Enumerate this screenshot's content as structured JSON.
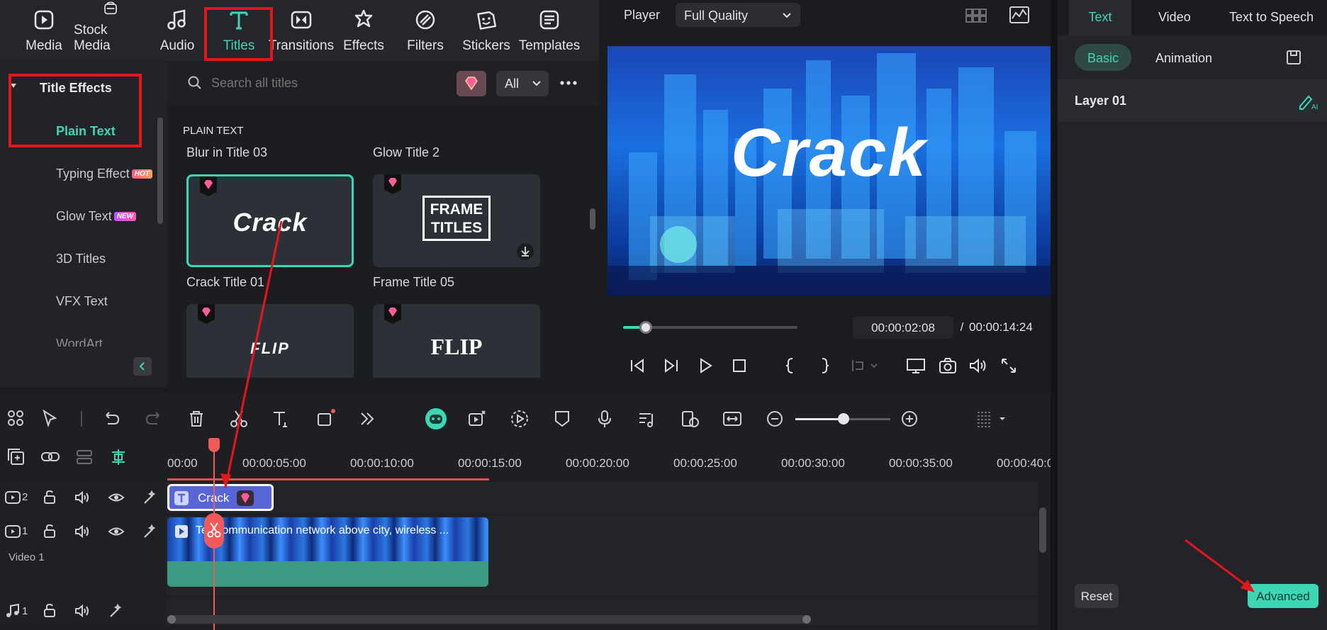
{
  "toolbar": {
    "items": [
      {
        "label": "Media",
        "icon": "media-icon"
      },
      {
        "label": "Stock Media",
        "icon": "stock-media-icon"
      },
      {
        "label": "Audio",
        "icon": "audio-icon"
      },
      {
        "label": "Titles",
        "icon": "titles-icon",
        "active": true
      },
      {
        "label": "Transitions",
        "icon": "transitions-icon"
      },
      {
        "label": "Effects",
        "icon": "effects-icon"
      },
      {
        "label": "Filters",
        "icon": "filters-icon"
      },
      {
        "label": "Stickers",
        "icon": "stickers-icon"
      },
      {
        "label": "Templates",
        "icon": "templates-icon"
      }
    ]
  },
  "categories": {
    "group_label": "Title Effects",
    "items": [
      {
        "label": "Plain Text",
        "active": true
      },
      {
        "label": "Typing Effect",
        "badge": "HOT"
      },
      {
        "label": "Glow Text",
        "badge": "NEW"
      },
      {
        "label": "3D Titles"
      },
      {
        "label": "VFX Text"
      },
      {
        "label": "WordArt"
      }
    ]
  },
  "browser": {
    "search_placeholder": "Search all titles",
    "filter_value": "All",
    "section_label": "PLAIN TEXT",
    "row1_labels": [
      "Blur in Title 03",
      "Glow Title 2"
    ],
    "row2_labels": [
      "Crack Title 01",
      "Frame Title 05"
    ],
    "thumb_texts": {
      "crack": "Crack",
      "frame_line1": "FRAME",
      "frame_line2": "TITLES",
      "flip1": "FLIP",
      "flip2": "FLIP"
    }
  },
  "player": {
    "label": "Player",
    "quality": "Full Quality",
    "preview_text": "Crack",
    "current_time": "00:00:02:08",
    "separator": "/",
    "total_time": "00:00:14:24",
    "progress": 0.13
  },
  "right_panel": {
    "tabs": [
      "Text",
      "Video",
      "Text to Speech"
    ],
    "subtabs": [
      "Basic",
      "Animation"
    ],
    "layer_label": "Layer 01",
    "reset_label": "Reset",
    "advanced_label": "Advanced"
  },
  "timeline": {
    "ruler": [
      "00:00",
      "00:00:05:00",
      "00:00:10:00",
      "00:00:15:00",
      "00:00:20:00",
      "00:00:25:00",
      "00:00:30:00",
      "00:00:35:00",
      "00:00:40:0"
    ],
    "tracks": [
      {
        "number": "2",
        "name": ""
      },
      {
        "number": "1",
        "name": "Video 1"
      },
      {
        "number": "1",
        "name": ""
      }
    ],
    "title_clip": "Crack",
    "video_clip": "Telecommunication network above city, wireless ..."
  },
  "colors": {
    "accent": "#3ed7b6",
    "highlight_red": "#e8141c",
    "clip_blue": "#5865d6",
    "playhead": "#f05a5a"
  }
}
